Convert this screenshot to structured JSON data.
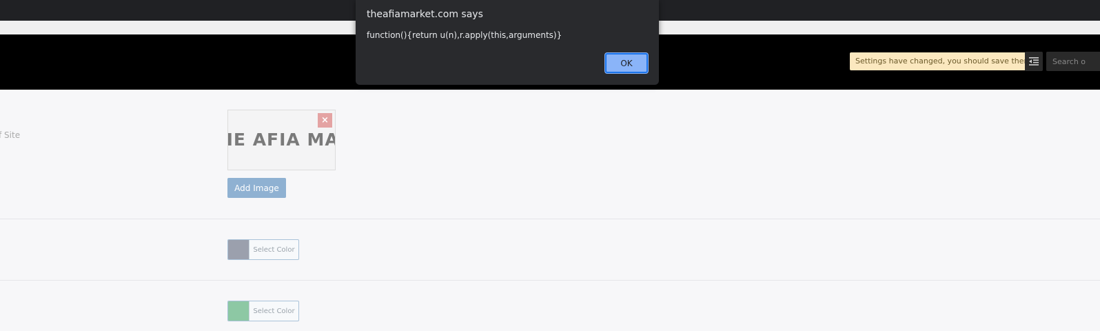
{
  "alert": {
    "title": "theafiamarket.com says",
    "message": "function(){return u(n),r.apply(this,arguments)}",
    "ok_label": "OK"
  },
  "header": {
    "save_notice": "Settings have changed, you should save them!",
    "collapse_icon": "outdent-icon",
    "search_placeholder": "Search o"
  },
  "settings": {
    "logo_row": {
      "label": "f Site",
      "logo_text": "HE AFIA MA",
      "remove_label": "×",
      "add_image_label": "Add Image"
    },
    "color_rows": [
      {
        "swatch_color": "#9ba0ad",
        "label": "Select Color"
      },
      {
        "swatch_color": "#8dc8a4",
        "label": "Select Color"
      }
    ]
  },
  "colors": {
    "chrome": "#202124",
    "header_bg": "#000000",
    "page_bg": "#f7f7f9",
    "notice_bg": "#fbe8bf",
    "button_blue": "#8fb1d2",
    "remove_red": "#e4a3a3",
    "dialog_bg": "#292a2d",
    "dialog_ok": "#8ab4f8"
  }
}
